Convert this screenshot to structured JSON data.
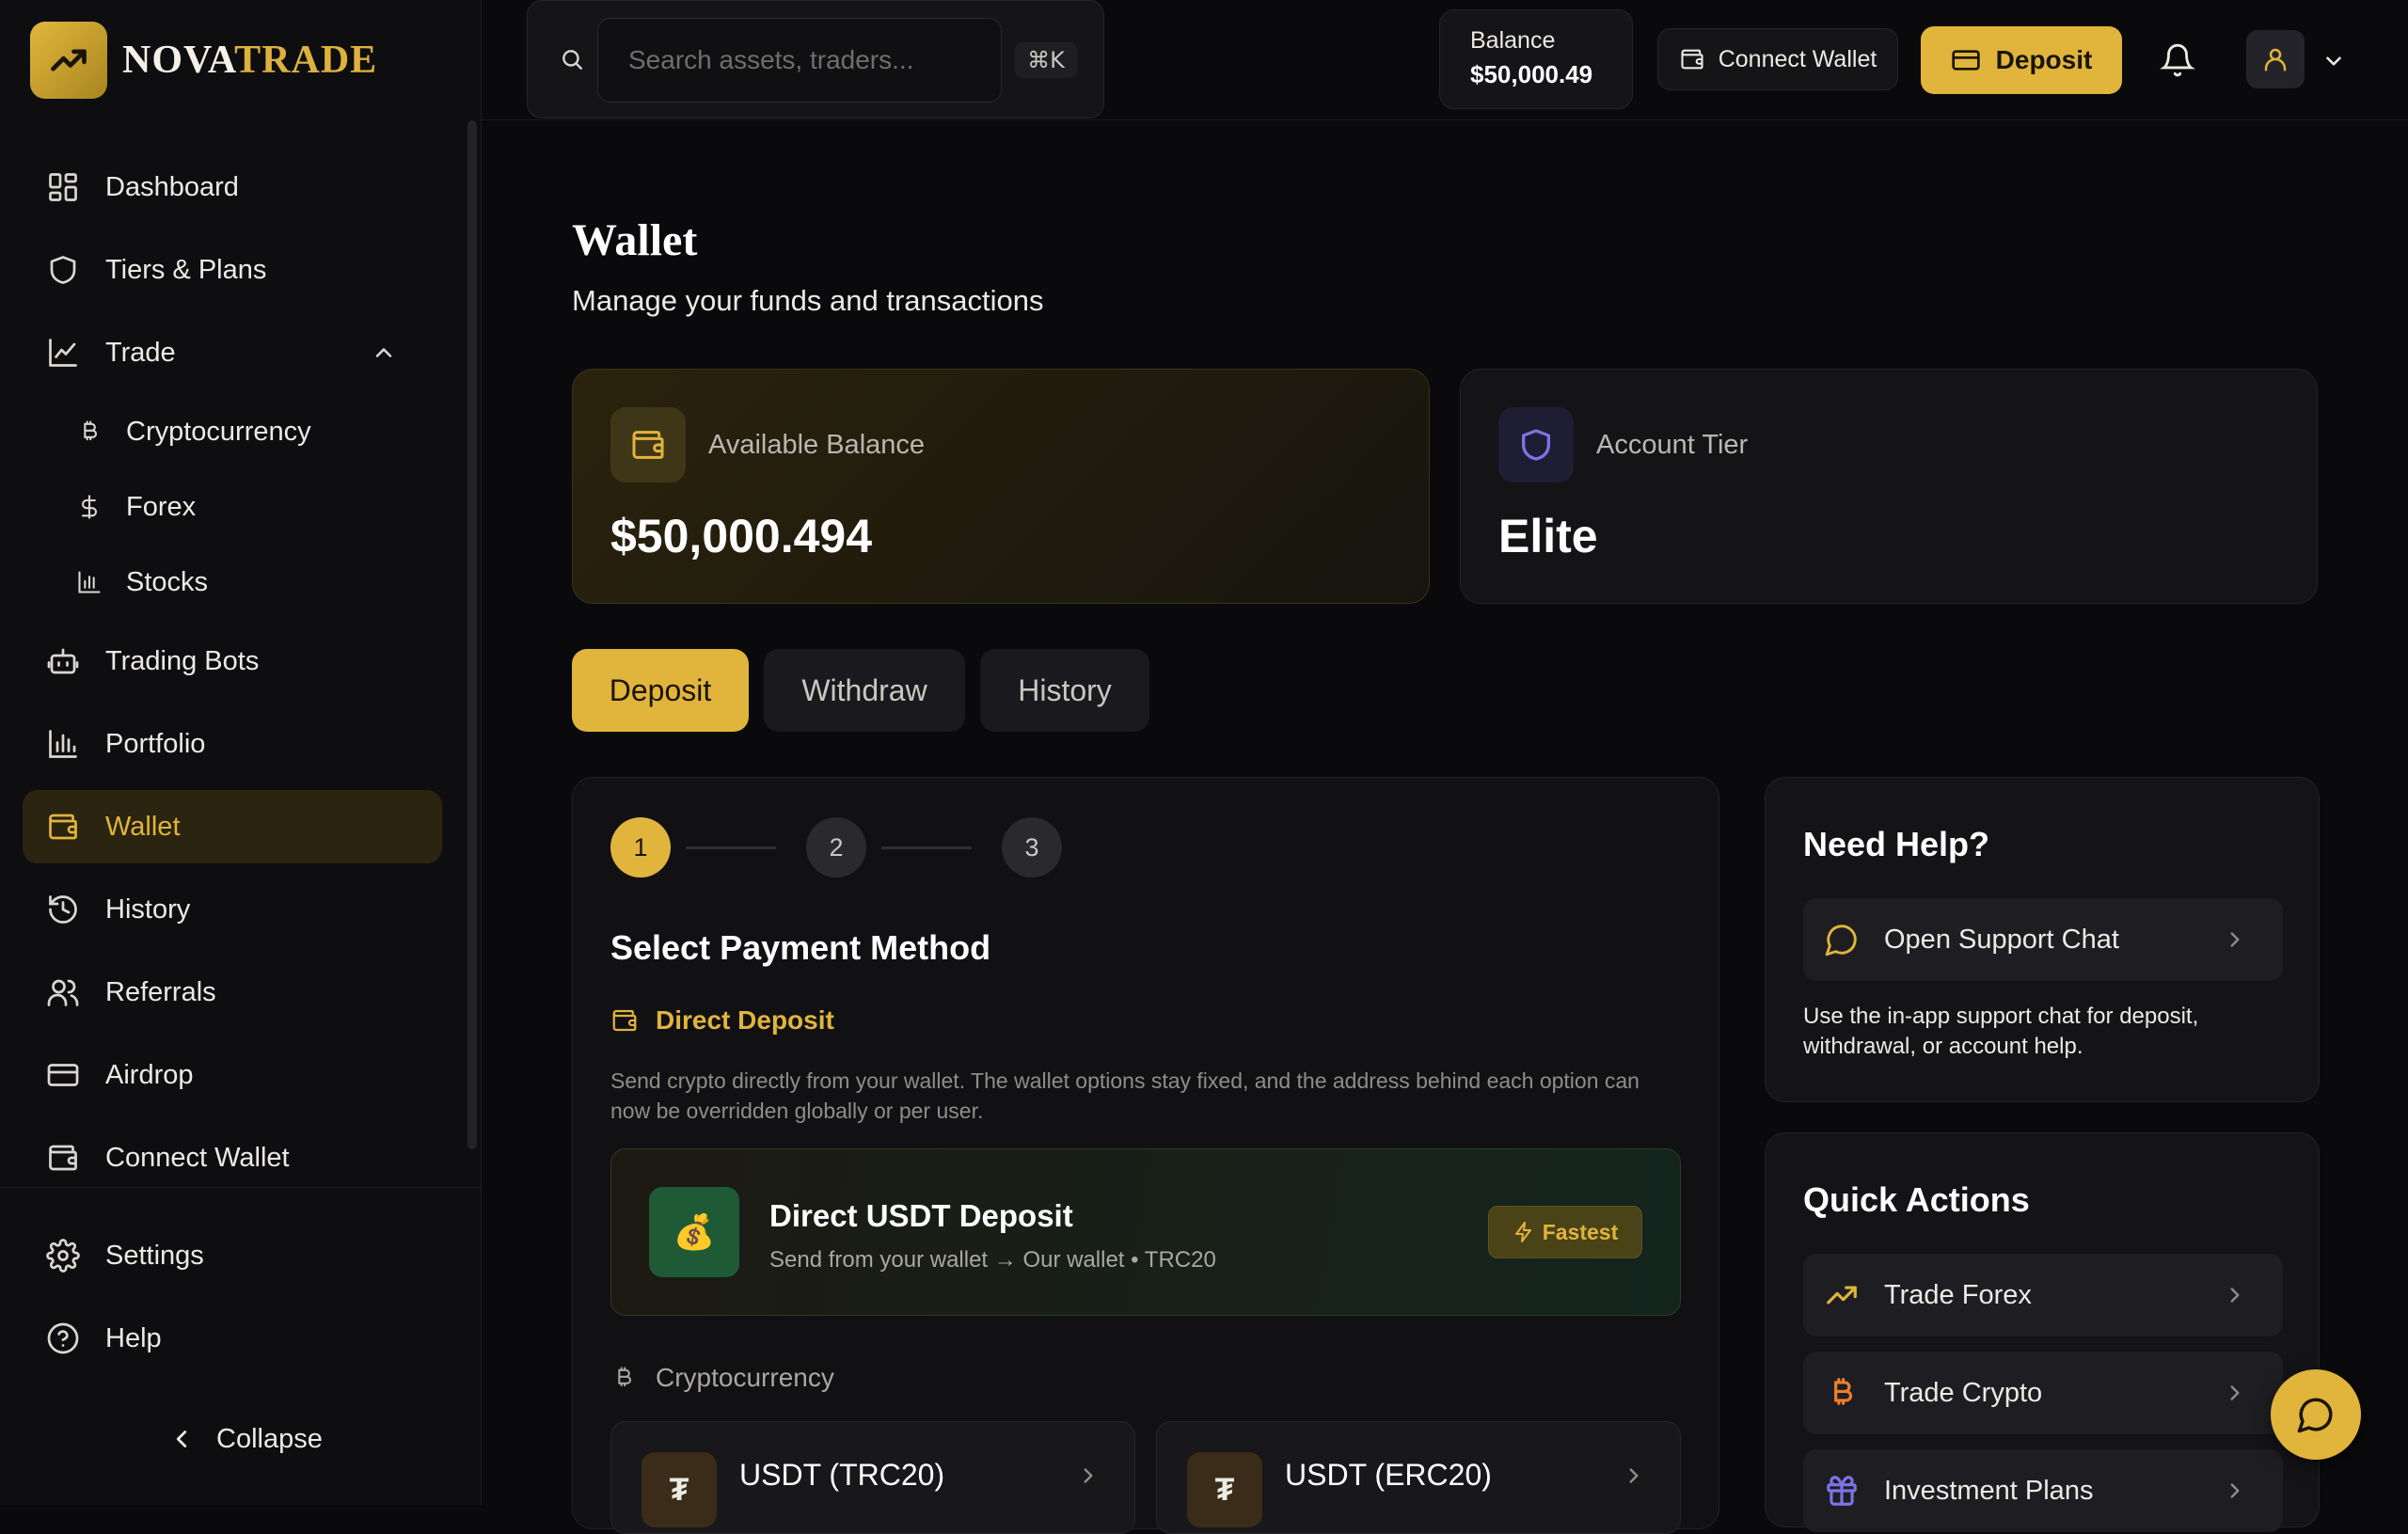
{
  "brand": {
    "name_a": "NOVA",
    "name_b": "TRADE"
  },
  "sidebar": {
    "items": [
      {
        "label": "Dashboard",
        "icon": "dashboard-icon"
      },
      {
        "label": "Tiers & Plans",
        "icon": "shield-icon"
      },
      {
        "label": "Trade",
        "icon": "line-chart-icon",
        "expanded": true
      },
      {
        "label": "Trading Bots",
        "icon": "bot-icon"
      },
      {
        "label": "Portfolio",
        "icon": "bar-chart-icon"
      },
      {
        "label": "Wallet",
        "icon": "wallet-icon",
        "active": true
      },
      {
        "label": "History",
        "icon": "history-icon"
      },
      {
        "label": "Referrals",
        "icon": "users-icon"
      },
      {
        "label": "Airdrop",
        "icon": "card-icon"
      },
      {
        "label": "Connect Wallet",
        "icon": "wallet-icon"
      },
      {
        "label": "Settings",
        "icon": "gear-icon"
      },
      {
        "label": "Help",
        "icon": "help-icon"
      }
    ],
    "trade_sub": [
      {
        "label": "Cryptocurrency",
        "icon": "bitcoin-icon"
      },
      {
        "label": "Forex",
        "icon": "dollar-icon"
      },
      {
        "label": "Stocks",
        "icon": "stocks-icon"
      }
    ],
    "collapse_label": "Collapse"
  },
  "topbar": {
    "search_placeholder": "Search assets, traders...",
    "shortcut": "⌘K",
    "balance_label": "Balance",
    "balance_value": "$50,000.49",
    "connect_wallet": "Connect Wallet",
    "deposit": "Deposit"
  },
  "page": {
    "title": "Wallet",
    "subtitle": "Manage your funds and transactions"
  },
  "cards": {
    "balance_label": "Available Balance",
    "balance_value": "$50,000.494",
    "tier_label": "Account Tier",
    "tier_value": "Elite"
  },
  "tabs": [
    {
      "label": "Deposit",
      "active": true
    },
    {
      "label": "Withdraw",
      "active": false
    },
    {
      "label": "History",
      "active": false
    }
  ],
  "steps": [
    "1",
    "2",
    "3"
  ],
  "deposit": {
    "section_title": "Select Payment Method",
    "direct_title": "Direct Deposit",
    "direct_desc": "Send crypto directly from your wallet. The wallet options stay fixed, and the address behind each option can now be overridden globally or per user.",
    "usdt_icon": "💰",
    "usdt_title": "Direct USDT Deposit",
    "usdt_sub": "Send from your wallet → Our wallet • TRC20",
    "badge": "Fastest",
    "crypto_label": "Cryptocurrency",
    "coins": [
      {
        "symbol": "₮",
        "label": "USDT (TRC20)"
      },
      {
        "symbol": "₮",
        "label": "USDT (ERC20)"
      }
    ]
  },
  "help": {
    "title": "Need Help?",
    "chat_label": "Open Support Chat",
    "desc": "Use the in-app support chat for deposit, withdrawal, or account help."
  },
  "quick_actions": {
    "title": "Quick Actions",
    "items": [
      {
        "label": "Trade Forex",
        "icon": "trending-up-icon"
      },
      {
        "label": "Trade Crypto",
        "icon": "bitcoin-icon"
      },
      {
        "label": "Investment Plans",
        "icon": "gift-icon"
      }
    ]
  },
  "colors": {
    "accent": "#e1b43c",
    "background": "#0a0a0c",
    "panel": "#141417",
    "tier_accent": "#7b74e6"
  }
}
